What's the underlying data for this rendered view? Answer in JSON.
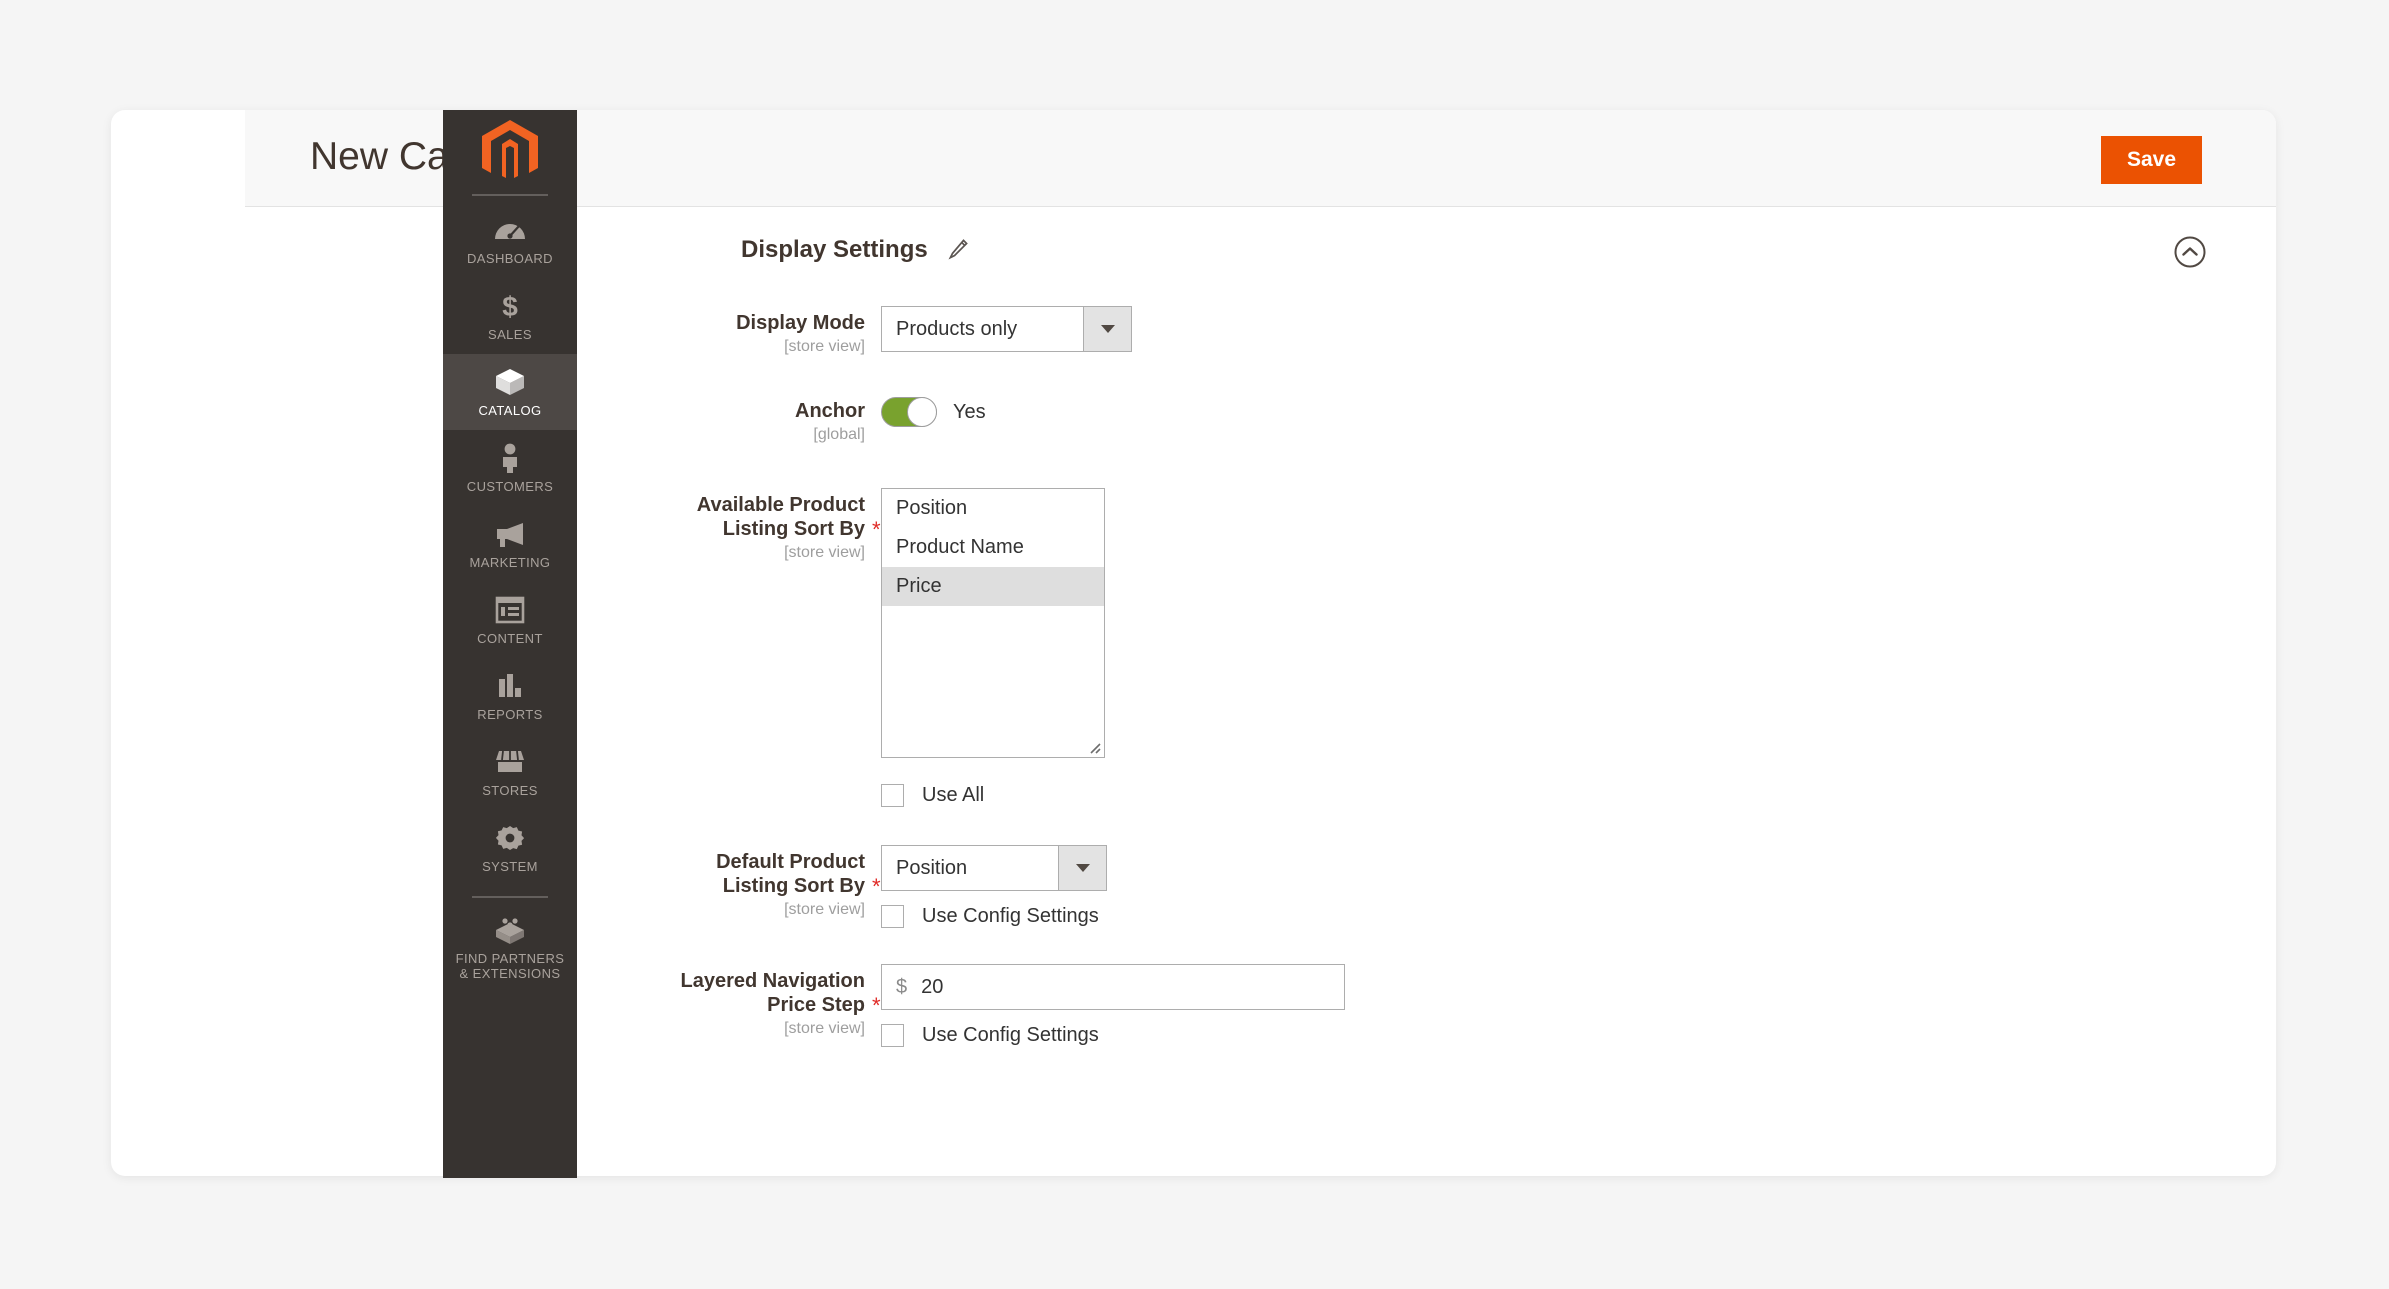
{
  "header": {
    "title": "New Category",
    "save_label": "Save"
  },
  "sidebar": {
    "logo_name": "magento-logo",
    "items": [
      {
        "label": "DASHBOARD",
        "icon": "dashboard-icon",
        "active": false
      },
      {
        "label": "SALES",
        "icon": "dollar-icon",
        "active": false
      },
      {
        "label": "CATALOG",
        "icon": "box-icon",
        "active": true
      },
      {
        "label": "CUSTOMERS",
        "icon": "person-icon",
        "active": false
      },
      {
        "label": "MARKETING",
        "icon": "megaphone-icon",
        "active": false
      },
      {
        "label": "CONTENT",
        "icon": "layout-icon",
        "active": false
      },
      {
        "label": "REPORTS",
        "icon": "bar-chart-icon",
        "active": false
      },
      {
        "label": "STORES",
        "icon": "storefront-icon",
        "active": false
      },
      {
        "label": "SYSTEM",
        "icon": "gear-icon",
        "active": false
      },
      {
        "label": "FIND PARTNERS\n& EXTENSIONS",
        "label_line1": "FIND PARTNERS",
        "label_line2": "& EXTENSIONS",
        "icon": "extensions-icon",
        "active": false
      }
    ]
  },
  "section": {
    "title": "Display Settings",
    "edit_icon": "pencil-icon",
    "collapse_icon": "chevron-up-circle-icon"
  },
  "fields": {
    "display_mode": {
      "label": "Display Mode",
      "scope": "[store view]",
      "value": "Products only",
      "required": false
    },
    "anchor": {
      "label": "Anchor",
      "scope": "[global]",
      "value": "Yes",
      "toggle_on": true,
      "required": false
    },
    "available_sort": {
      "label_line1": "Available Product",
      "label_line2": "Listing Sort By",
      "scope": "[store view]",
      "required": true,
      "required_mark": "*",
      "options": [
        "Position",
        "Product Name",
        "Price"
      ],
      "selected": [
        "Price"
      ],
      "use_all_label": "Use All",
      "use_all_checked": false
    },
    "default_sort": {
      "label_line1": "Default Product",
      "label_line2": "Listing Sort By",
      "scope": "[store view]",
      "required": true,
      "required_mark": "*",
      "value": "Position",
      "use_config_label": "Use Config Settings",
      "use_config_checked": false
    },
    "price_step": {
      "label_line1": "Layered Navigation",
      "label_line2": "Price Step",
      "scope": "[store view]",
      "required": true,
      "required_mark": "*",
      "currency_symbol": "$",
      "value": "20",
      "use_config_label": "Use Config Settings",
      "use_config_checked": false
    }
  },
  "colors": {
    "brand_orange": "#eb5202",
    "sidebar_bg": "#373330",
    "sidebar_active": "#4d4845",
    "toggle_green": "#79a22e",
    "required_red": "#e02b27"
  }
}
